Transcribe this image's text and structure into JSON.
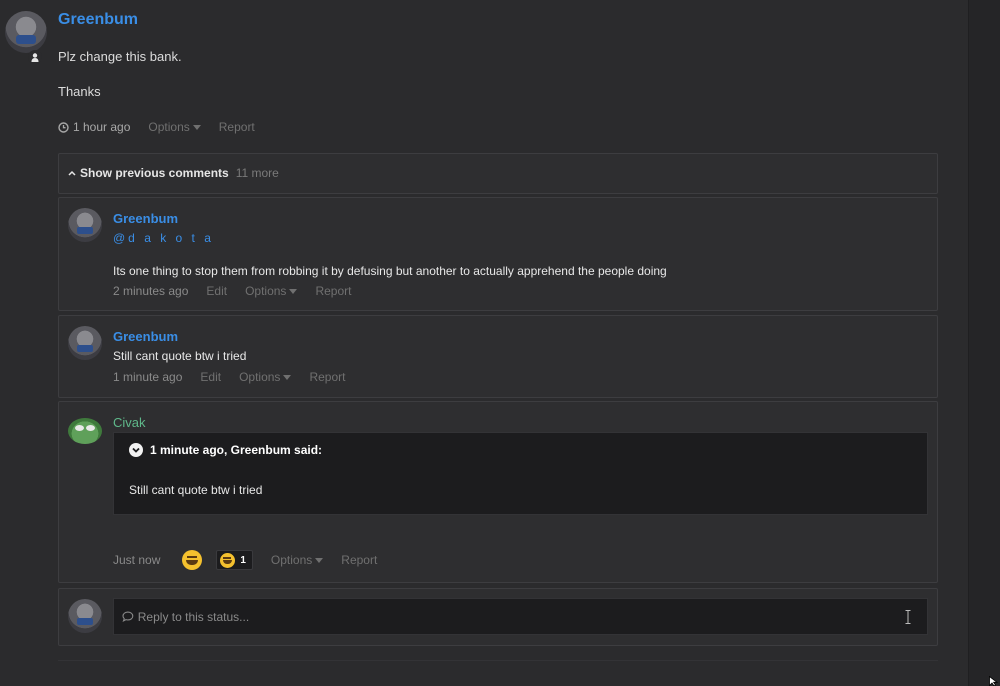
{
  "post": {
    "author": "Greenbum",
    "lines": [
      "Plz change this bank.",
      "Thanks"
    ],
    "time": "1 hour ago",
    "options_label": "Options",
    "report_label": "Report"
  },
  "comments_toggle": {
    "label": "Show previous comments",
    "count": "11 more"
  },
  "comments": [
    {
      "author": "Greenbum",
      "mention": "@d a k o t a",
      "text": "Its one thing to stop them from robbing it by defusing but another to actually apprehend the people doing",
      "time": "2 minutes ago",
      "edit_label": "Edit",
      "options_label": "Options",
      "report_label": "Report"
    },
    {
      "author": "Greenbum",
      "text": "Still cant quote btw i tried",
      "time": "1 minute ago",
      "edit_label": "Edit",
      "options_label": "Options",
      "report_label": "Report"
    },
    {
      "author": "Civak",
      "quote_header": "1 minute ago, Greenbum said:",
      "quote_text": "Still cant quote btw i tried",
      "time": "Just now",
      "reaction_count": "1",
      "options_label": "Options",
      "report_label": "Report"
    }
  ],
  "reply": {
    "placeholder": "Reply to this status..."
  },
  "icons": {
    "user_badge": "user-icon",
    "clock": "clock-icon",
    "chevron_up": "chevron-up-icon",
    "quote_chevron": "chevron-down-icon",
    "reaction": "grin-emoji-icon",
    "comment": "comment-icon"
  },
  "colors": {
    "accent_blue": "#3a8ee6",
    "background": "#2b2b2d"
  }
}
